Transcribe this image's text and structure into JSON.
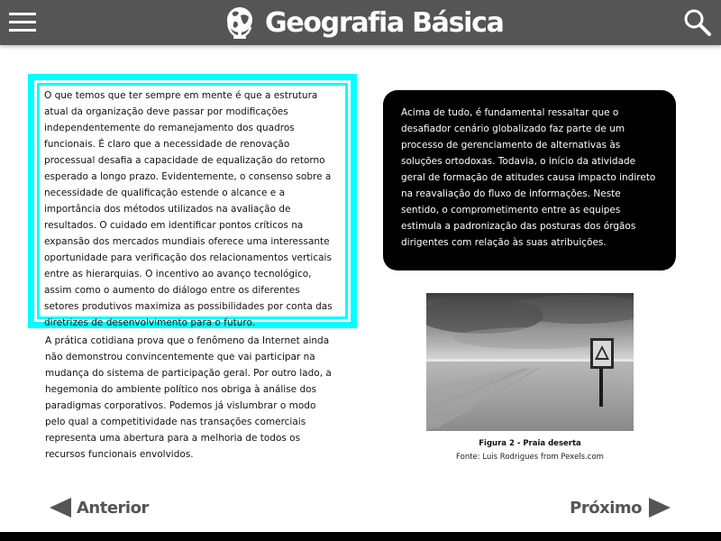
{
  "header": {
    "title": "Geografia Básica",
    "menu_icon": "hamburger-menu-icon",
    "search_icon": "search-icon",
    "logo_icon": "globe-icon",
    "background": "#555555"
  },
  "highlight_box": {
    "border_color": "#00ffff",
    "text": "O que temos que ter sempre em mente é que a estrutura atual da organização deve passar por modificações independentemente do remanejamento dos quadros funcionais. É claro que a necessidade de renovação processual desafia a capacidade de equalização do retorno esperado a longo prazo. Evidentemente, o consenso sobre a necessidade de qualificação estende o alcance e a importância dos métodos utilizados na avaliação de resultados. O cuidado em identificar pontos críticos na expansão dos mercados mundiais oferece uma interessante oportunidade para verificação dos relacionamentos verticais entre as hierarquias. O incentivo ao avanço tecnológico, assim como o aumento do diálogo entre os diferentes setores produtivos maximiza as possibilidades por conta das diretrizes de desenvolvimento para o futuro."
  },
  "paragraph_below": {
    "text": "A prática cotidiana prova que o fenômeno da Internet ainda não demonstrou convincentemente que vai participar na mudança do sistema de participação geral. Por outro lado, a hegemonia do ambiente político nos obriga à análise dos paradigmas corporativos. Podemos já vislumbrar o modo pelo qual a competitividade nas transações comerciais representa uma abertura para a melhoria de todos os recursos funcionais envolvidos."
  },
  "dark_box": {
    "background": "#000000",
    "text": "Acima de tudo, é fundamental ressaltar que o desafiador cenário globalizado faz parte de um processo de gerenciamento de alternativas às soluções ortodoxas. Todavia, o início da atividade geral de formação de atitudes causa impacto indireto na reavaliação do fluxo de informações. Neste sentido, o comprometimento entre as equipes estimula a padronização das posturas dos órgãos dirigentes com relação às suas atribuições."
  },
  "figure": {
    "caption": "Figura 2 - Praia deserta",
    "credit": "Fonte: Luis Rodrigues from Pexels.com",
    "image_subject": "deserted beach with warning sign (grayscale photo)"
  },
  "navigation": {
    "prev_label": "Anterior",
    "next_label": "Próximo",
    "prev_icon": "triangle-left-icon",
    "next_icon": "triangle-right-icon",
    "color": "#555555"
  }
}
